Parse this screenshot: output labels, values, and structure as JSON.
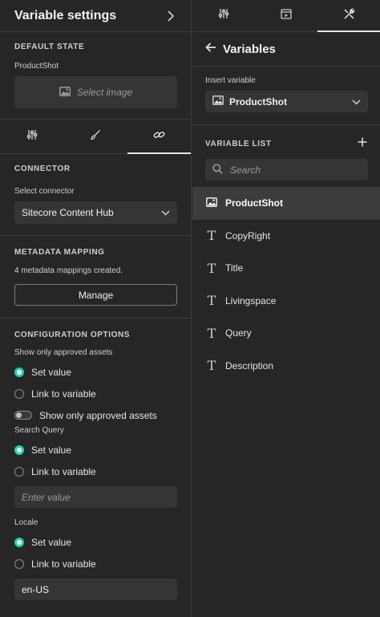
{
  "left": {
    "title": "Variable settings",
    "default_state": {
      "heading": "DEFAULT STATE",
      "field_label": "ProductShot",
      "select_image_label": "Select image"
    },
    "connector": {
      "heading": "CONNECTOR",
      "select_label": "Select connector",
      "selected_value": "Sitecore Content Hub"
    },
    "metadata": {
      "heading": "METADATA MAPPING",
      "summary": "4 metadata mappings created.",
      "manage_label": "Manage"
    },
    "config": {
      "heading": "CONFIGURATION OPTIONS",
      "approved_label": "Show only approved assets",
      "approved_set_value": "Set value",
      "approved_link": "Link to variable",
      "approved_toggle_label": "Show only approved assets",
      "approved_toggle_on": false,
      "query_label": "Search Query",
      "query_set_value": "Set value",
      "query_link": "Link to variable",
      "query_placeholder": "Enter value",
      "locale_label": "Locale",
      "locale_set_value": "Set value",
      "locale_link": "Link to variable",
      "locale_value": "en-US"
    }
  },
  "right": {
    "title": "Variables",
    "insert_label": "Insert variable",
    "insert_selected": "ProductShot",
    "list_heading": "VARIABLE LIST",
    "search_placeholder": "Search",
    "items": [
      {
        "label": "ProductShot",
        "type": "image",
        "selected": true
      },
      {
        "label": "CopyRight",
        "type": "text",
        "selected": false
      },
      {
        "label": "Title",
        "type": "text",
        "selected": false
      },
      {
        "label": "Livingspace",
        "type": "text",
        "selected": false
      },
      {
        "label": "Query",
        "type": "text",
        "selected": false
      },
      {
        "label": "Description",
        "type": "text",
        "selected": false
      }
    ]
  },
  "colors": {
    "accent": "#19d3b1",
    "panel_bg": "#262626",
    "field_bg": "#353535"
  }
}
